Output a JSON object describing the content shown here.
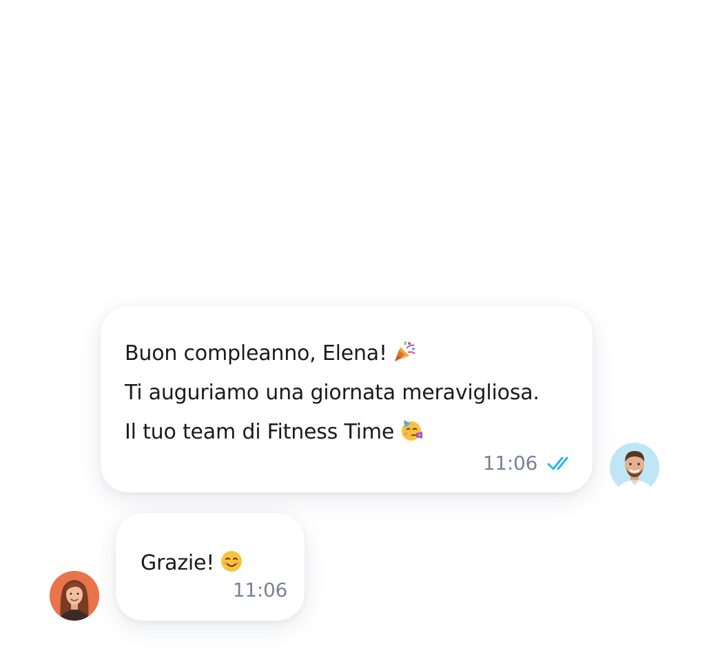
{
  "conversation": {
    "outgoing": {
      "lines": [
        "Buon compleanno, Elena!",
        "Ti auguriamo una giornata meravigliosa.",
        "Il tuo team di Fitness Time"
      ],
      "line_emojis": [
        "party-popper",
        "",
        "partying-face"
      ],
      "time": "11:06",
      "status_icon": "double-check-icon",
      "status_color": "#2bb5ee",
      "avatar_icon": "man-avatar",
      "avatar_bg": "#bfe6f7"
    },
    "incoming": {
      "text": "Grazie!",
      "emoji": "smiling-face",
      "time": "11:06",
      "avatar_icon": "woman-avatar",
      "avatar_bg": "#e9734a"
    }
  }
}
